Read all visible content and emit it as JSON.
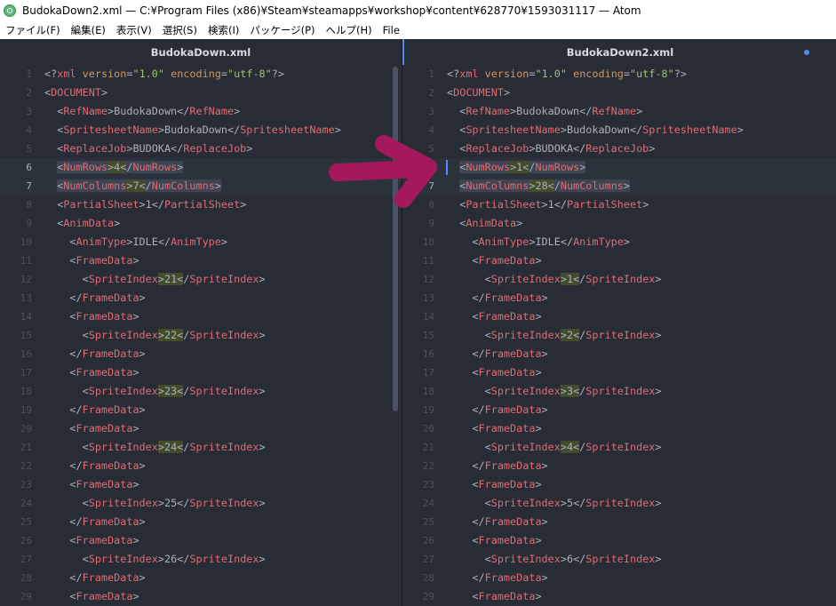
{
  "window": {
    "title": "BudokaDown2.xml — C:¥Program Files (x86)¥Steam¥steamapps¥workshop¥content¥628770¥1593031117 — Atom"
  },
  "menu": [
    "ファイル(F)",
    "編集(E)",
    "表示(V)",
    "選択(S)",
    "検索(I)",
    "パッケージ(P)",
    "ヘルプ(H)",
    "File"
  ],
  "left": {
    "tab": "BudokaDown.xml",
    "current_lines": [
      6,
      7
    ],
    "lines": [
      {
        "n": 1,
        "code": "<?xml version=\"1.0\" encoding=\"utf-8\"?>"
      },
      {
        "n": 2,
        "code": "<DOCUMENT>"
      },
      {
        "n": 3,
        "code": "  <RefName>BudokaDown</RefName>"
      },
      {
        "n": 4,
        "code": "  <SpritesheetName>BudokaDown</SpritesheetName>"
      },
      {
        "n": 5,
        "code": "  <ReplaceJob>BUDOKA</ReplaceJob>"
      },
      {
        "n": 6,
        "code": "  <NumRows>4</NumRows>"
      },
      {
        "n": 7,
        "code": "  <NumColumns>7</NumColumns>"
      },
      {
        "n": 8,
        "code": "  <PartialSheet>1</PartialSheet>"
      },
      {
        "n": 9,
        "code": "  <AnimData>"
      },
      {
        "n": 10,
        "code": "    <AnimType>IDLE</AnimType>"
      },
      {
        "n": 11,
        "code": "    <FrameData>"
      },
      {
        "n": 12,
        "code": "      <SpriteIndex>21</SpriteIndex>"
      },
      {
        "n": 13,
        "code": "    </FrameData>"
      },
      {
        "n": 14,
        "code": "    <FrameData>"
      },
      {
        "n": 15,
        "code": "      <SpriteIndex>22</SpriteIndex>"
      },
      {
        "n": 16,
        "code": "    </FrameData>"
      },
      {
        "n": 17,
        "code": "    <FrameData>"
      },
      {
        "n": 18,
        "code": "      <SpriteIndex>23</SpriteIndex>"
      },
      {
        "n": 19,
        "code": "    </FrameData>"
      },
      {
        "n": 20,
        "code": "    <FrameData>"
      },
      {
        "n": 21,
        "code": "      <SpriteIndex>24</SpriteIndex>"
      },
      {
        "n": 22,
        "code": "    </FrameData>"
      },
      {
        "n": 23,
        "code": "    <FrameData>"
      },
      {
        "n": 24,
        "code": "      <SpriteIndex>25</SpriteIndex>"
      },
      {
        "n": 25,
        "code": "    </FrameData>"
      },
      {
        "n": 26,
        "code": "    <FrameData>"
      },
      {
        "n": 27,
        "code": "      <SpriteIndex>26</SpriteIndex>"
      },
      {
        "n": 28,
        "code": "    </FrameData>"
      },
      {
        "n": 29,
        "code": "    <FrameData>"
      }
    ]
  },
  "right": {
    "tab": "BudokaDown2.xml",
    "modified": true,
    "current_lines": [
      6,
      7
    ],
    "lines": [
      {
        "n": 1,
        "code": "<?xml version=\"1.0\" encoding=\"utf-8\"?>"
      },
      {
        "n": 2,
        "code": "<DOCUMENT>"
      },
      {
        "n": 3,
        "code": "  <RefName>BudokaDown</RefName>"
      },
      {
        "n": 4,
        "code": "  <SpritesheetName>BudokaDown</SpritesheetName>"
      },
      {
        "n": 5,
        "code": "  <ReplaceJob>BUDOKA</ReplaceJob>"
      },
      {
        "n": 6,
        "code": "  <NumRows>1</NumRows>"
      },
      {
        "n": 7,
        "code": "  <NumColumns>28</NumColumns>"
      },
      {
        "n": 8,
        "code": "  <PartialSheet>1</PartialSheet>"
      },
      {
        "n": 9,
        "code": "  <AnimData>"
      },
      {
        "n": 10,
        "code": "    <AnimType>IDLE</AnimType>"
      },
      {
        "n": 11,
        "code": "    <FrameData>"
      },
      {
        "n": 12,
        "code": "      <SpriteIndex>1</SpriteIndex>"
      },
      {
        "n": 13,
        "code": "    </FrameData>"
      },
      {
        "n": 14,
        "code": "    <FrameData>"
      },
      {
        "n": 15,
        "code": "      <SpriteIndex>2</SpriteIndex>"
      },
      {
        "n": 16,
        "code": "    </FrameData>"
      },
      {
        "n": 17,
        "code": "    <FrameData>"
      },
      {
        "n": 18,
        "code": "      <SpriteIndex>3</SpriteIndex>"
      },
      {
        "n": 19,
        "code": "    </FrameData>"
      },
      {
        "n": 20,
        "code": "    <FrameData>"
      },
      {
        "n": 21,
        "code": "      <SpriteIndex>4</SpriteIndex>"
      },
      {
        "n": 22,
        "code": "    </FrameData>"
      },
      {
        "n": 23,
        "code": "    <FrameData>"
      },
      {
        "n": 24,
        "code": "      <SpriteIndex>5</SpriteIndex>"
      },
      {
        "n": 25,
        "code": "    </FrameData>"
      },
      {
        "n": 26,
        "code": "    <FrameData>"
      },
      {
        "n": 27,
        "code": "      <SpriteIndex>6</SpriteIndex>"
      },
      {
        "n": 28,
        "code": "    </FrameData>"
      },
      {
        "n": 29,
        "code": "    <FrameData>"
      }
    ]
  },
  "colors": {
    "arrow": "#a3195b",
    "tag": "#e06c75",
    "attr": "#d19a66",
    "string": "#98c379",
    "accent": "#568af2"
  },
  "icons": {
    "app": "atom-icon",
    "arrow": "right-arrow-annotation-icon"
  }
}
